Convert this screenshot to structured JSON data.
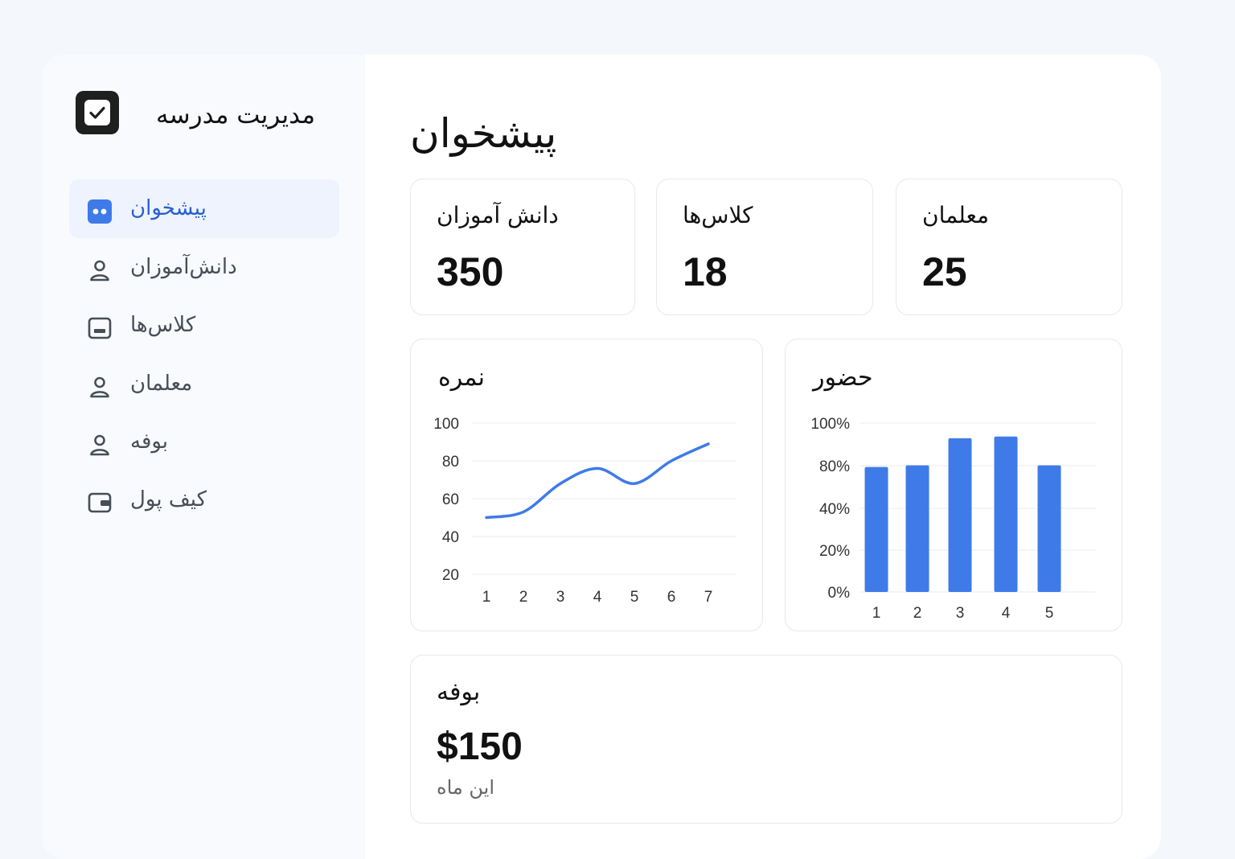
{
  "sidebar": {
    "brand_title": "مدیریت مدرسه",
    "items": [
      {
        "label": "پیشخوان",
        "icon": "dashboard-icon",
        "active": true
      },
      {
        "label": "دانش‌آموزان",
        "icon": "user-icon",
        "active": false
      },
      {
        "label": "کلاس‌ها",
        "icon": "classroom-icon",
        "active": false
      },
      {
        "label": "معلمان",
        "icon": "user-icon",
        "active": false
      },
      {
        "label": "بوفه",
        "icon": "user-icon",
        "active": false
      },
      {
        "label": "کیف پول",
        "icon": "wallet-icon",
        "active": false
      }
    ]
  },
  "main": {
    "title": "پیشخوان",
    "stats": [
      {
        "label": "دانش آموزان",
        "value": "350"
      },
      {
        "label": "کلاس‌ها",
        "value": "18"
      },
      {
        "label": "معلمان",
        "value": "25"
      }
    ],
    "buffet": {
      "title": "بوفه",
      "amount": "$150",
      "period": "این ماه"
    }
  },
  "colors": {
    "accent": "#3f7be8",
    "active_text": "#2a5fcf",
    "active_bg": "#eef3fd"
  },
  "chart_data": [
    {
      "type": "line",
      "title": "نمره",
      "x": [
        1,
        2,
        3,
        4,
        5,
        6,
        7
      ],
      "series": [
        {
          "values": [
            50,
            53,
            68,
            76,
            68,
            80,
            89
          ]
        }
      ],
      "yticks": [
        20,
        40,
        60,
        80,
        100
      ],
      "ylim": [
        20,
        100
      ],
      "grid": true
    },
    {
      "type": "bar",
      "title": "حضور",
      "categories": [
        "1",
        "2",
        "3",
        "4",
        "5"
      ],
      "values": [
        74,
        75,
        91,
        92,
        75
      ],
      "ytick_labels": [
        "0%",
        "20%",
        "40%",
        "80%",
        "100%"
      ],
      "grid": true
    }
  ]
}
